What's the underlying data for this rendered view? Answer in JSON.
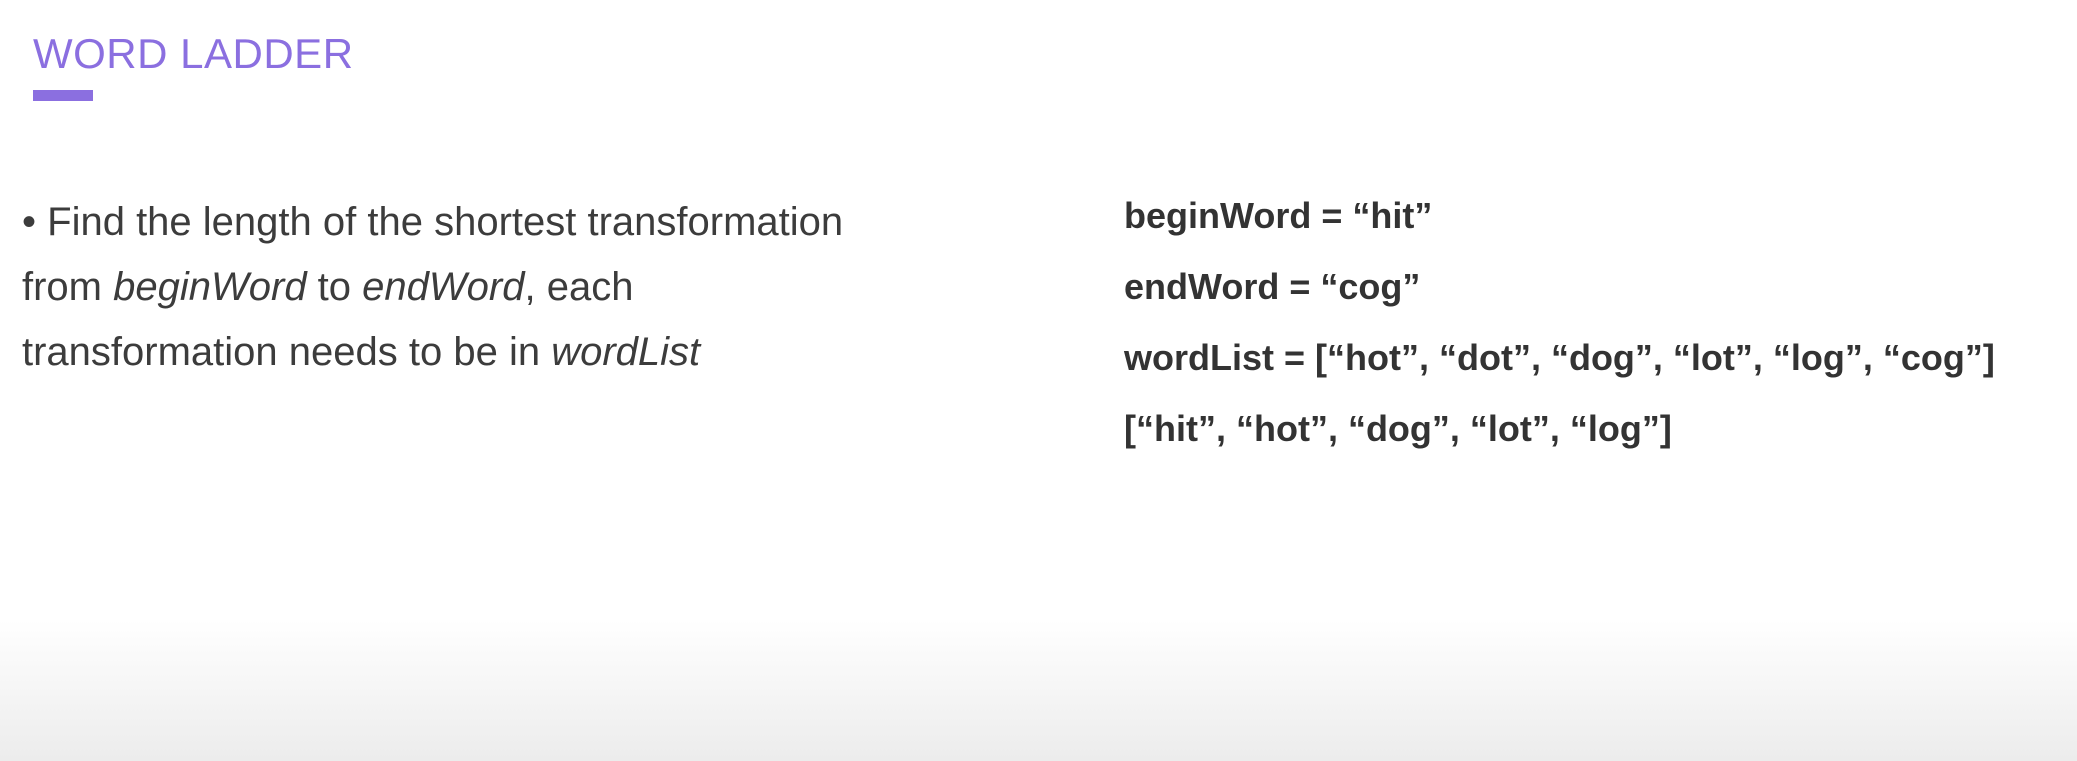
{
  "slide": {
    "title": "WORD LADDER",
    "accent_color": "#8b6fe0",
    "bullet": {
      "marker": "•",
      "line1": "Find the length of the shortest transformation",
      "line2_part1": "from ",
      "line2_em1": "beginWord",
      "line2_part2": " to ",
      "line2_em2": "endWord",
      "line2_part3": ", each",
      "line3_part1": "transformation needs to be in ",
      "line3_em": "wordList"
    },
    "example": {
      "begin_word": "beginWord = “hit”",
      "end_word": "endWord = “cog”",
      "word_list": "wordList = [“hot”, “dot”, “dog”, “lot”, “log”, “cog”]",
      "path": "[“hit”, “hot”, “dog”, “lot”, “log”]"
    }
  }
}
